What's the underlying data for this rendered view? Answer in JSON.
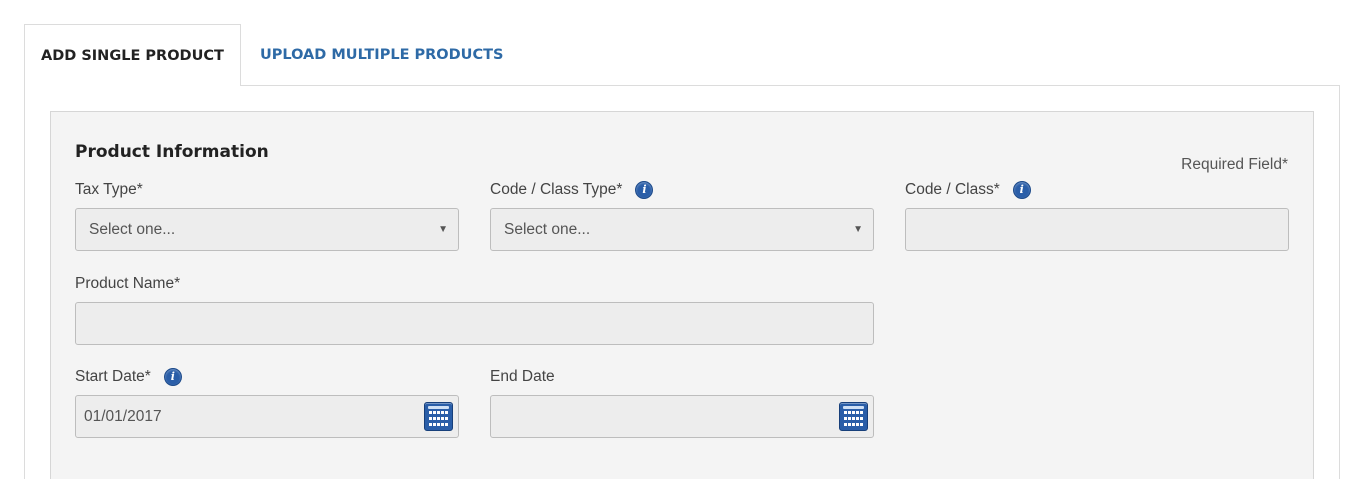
{
  "tabs": {
    "add_single": "ADD SINGLE PRODUCT",
    "upload_multiple": "UPLOAD MULTIPLE PRODUCTS"
  },
  "section": {
    "title": "Product Information",
    "required_note": "Required Field*"
  },
  "fields": {
    "tax_type": {
      "label": "Tax Type*",
      "value": "Select one..."
    },
    "code_class_type": {
      "label": "Code / Class Type*",
      "value": "Select one..."
    },
    "code_class": {
      "label": "Code / Class*",
      "value": ""
    },
    "product_name": {
      "label": "Product Name*",
      "value": ""
    },
    "start_date": {
      "label": "Start Date*",
      "value": "01/01/2017"
    },
    "end_date": {
      "label": "End Date",
      "value": ""
    }
  },
  "icons": {
    "info": "info-icon",
    "calendar": "calendar-icon",
    "dropdown": "caret-down-icon"
  },
  "colors": {
    "link_blue": "#2e6aa6",
    "icon_blue": "#2a5ea8",
    "panel_bg": "#f4f4f4",
    "input_bg": "#ededed"
  }
}
